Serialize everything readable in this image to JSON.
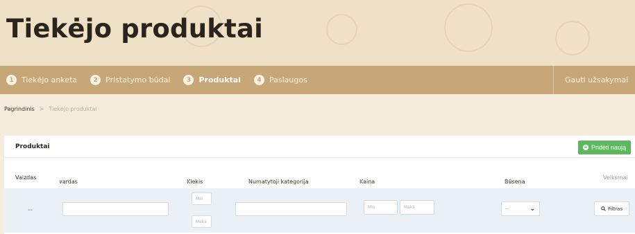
{
  "hero": {
    "title": "Tiekėjo produktai"
  },
  "steps": [
    {
      "num": "1",
      "label": "Tiekėjo anketa"
    },
    {
      "num": "2",
      "label": "Pristatymo būdai"
    },
    {
      "num": "3",
      "label": "Produktai"
    },
    {
      "num": "4",
      "label": "Paslaugos"
    }
  ],
  "stepbar_right": "Gauti užsakymai",
  "breadcrumb": {
    "home": "Pagrindinis",
    "separator": ">",
    "current": "Tiekėjo produktai"
  },
  "panel": {
    "title": "Produktai",
    "add_button": "Pridėti naują"
  },
  "table": {
    "columns": {
      "image": "Vaizdas",
      "name": "vardas",
      "quantity": "Kiekis",
      "category": "Numatytoji kategorija",
      "price": "Kaina",
      "status": "Būsena",
      "actions": "Veiksmai"
    },
    "sort_glyph": "▾ ▴",
    "filters": {
      "image_dash": "--",
      "qty_min": "Min",
      "qty_max": "Maks",
      "price_min": "Min",
      "price_max": "Maks",
      "status_value": "--",
      "filter_button": "Filtras"
    }
  },
  "colors": {
    "accent_bar": "#c7a677",
    "add_button": "#5cb85c",
    "filter_row": "#e9f1f7"
  }
}
